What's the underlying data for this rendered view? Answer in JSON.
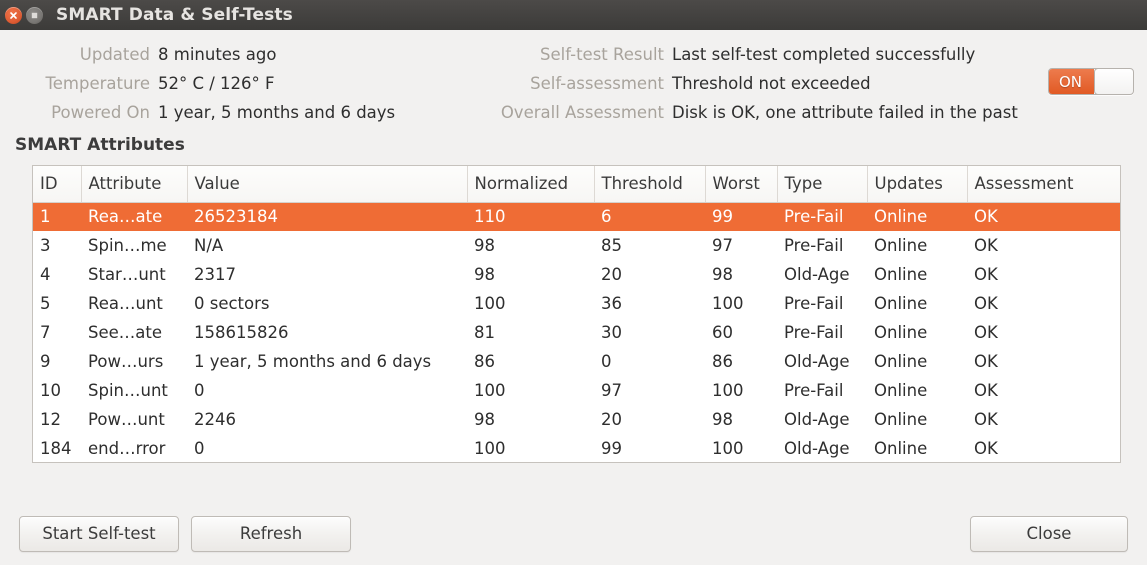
{
  "window": {
    "title": "SMART Data & Self-Tests",
    "close_icon": "window-close-icon",
    "maximize_icon": "window-maximize-icon"
  },
  "info": {
    "left": [
      {
        "label": "Updated",
        "value": "8 minutes ago"
      },
      {
        "label": "Temperature",
        "value": "52° C / 126° F"
      },
      {
        "label": "Powered On",
        "value": "1 year, 5 months and 6 days"
      }
    ],
    "right": [
      {
        "label": "Self-test Result",
        "value": "Last self-test completed successfully"
      },
      {
        "label": "Self-assessment",
        "value": "Threshold not exceeded"
      },
      {
        "label": "Overall Assessment",
        "value": "Disk is OK, one attribute failed in the past"
      }
    ]
  },
  "toggle": {
    "state_label": "ON",
    "on": true,
    "on_color": "#e15a24"
  },
  "section": {
    "attributes_title": "SMART Attributes"
  },
  "table": {
    "columns": [
      "ID",
      "Attribute",
      "Value",
      "Normalized",
      "Threshold",
      "Worst",
      "Type",
      "Updates",
      "Assessment"
    ],
    "selected_row_index": 0,
    "selection_color": "#ef6c35",
    "rows": [
      {
        "id": "1",
        "attribute": "Rea…ate",
        "value": "26523184",
        "normalized": "110",
        "threshold": "6",
        "worst": "99",
        "type": "Pre-Fail",
        "updates": "Online",
        "assessment": "OK"
      },
      {
        "id": "3",
        "attribute": "Spin…me",
        "value": "N/A",
        "normalized": "98",
        "threshold": "85",
        "worst": "97",
        "type": "Pre-Fail",
        "updates": "Online",
        "assessment": "OK"
      },
      {
        "id": "4",
        "attribute": "Star…unt",
        "value": "2317",
        "normalized": "98",
        "threshold": "20",
        "worst": "98",
        "type": "Old-Age",
        "updates": "Online",
        "assessment": "OK"
      },
      {
        "id": "5",
        "attribute": "Rea…unt",
        "value": "0 sectors",
        "normalized": "100",
        "threshold": "36",
        "worst": "100",
        "type": "Pre-Fail",
        "updates": "Online",
        "assessment": "OK"
      },
      {
        "id": "7",
        "attribute": "See…ate",
        "value": "158615826",
        "normalized": "81",
        "threshold": "30",
        "worst": "60",
        "type": "Pre-Fail",
        "updates": "Online",
        "assessment": "OK"
      },
      {
        "id": "9",
        "attribute": "Pow…urs",
        "value": "1 year, 5 months and 6 days",
        "normalized": "86",
        "threshold": "0",
        "worst": "86",
        "type": "Old-Age",
        "updates": "Online",
        "assessment": "OK"
      },
      {
        "id": "10",
        "attribute": "Spin…unt",
        "value": "0",
        "normalized": "100",
        "threshold": "97",
        "worst": "100",
        "type": "Pre-Fail",
        "updates": "Online",
        "assessment": "OK"
      },
      {
        "id": "12",
        "attribute": "Pow…unt",
        "value": "2246",
        "normalized": "98",
        "threshold": "20",
        "worst": "98",
        "type": "Old-Age",
        "updates": "Online",
        "assessment": "OK"
      },
      {
        "id": "184",
        "attribute": "end…rror",
        "value": "0",
        "normalized": "100",
        "threshold": "99",
        "worst": "100",
        "type": "Old-Age",
        "updates": "Online",
        "assessment": "OK"
      }
    ]
  },
  "footer": {
    "start_self_test": "Start Self-test",
    "refresh": "Refresh",
    "close": "Close"
  }
}
